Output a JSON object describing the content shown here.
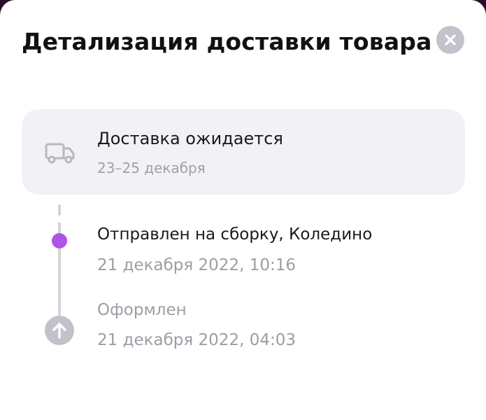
{
  "modal": {
    "title": "Детализация доставки товара",
    "close_icon": "close-icon"
  },
  "expected": {
    "icon": "truck-icon",
    "title": "Доставка ожидается",
    "date_range": "23–25 декабря"
  },
  "timeline": [
    {
      "title": "Отправлен на сборку, Коледино",
      "date": "21 декабря 2022, 10:16",
      "marker": "dot",
      "marker_color": "#b152e6"
    },
    {
      "title": "Оформлен",
      "date": "21 декабря 2022, 04:03",
      "marker": "arrow-up-icon",
      "marker_color": "#c2c2cb"
    }
  ]
}
